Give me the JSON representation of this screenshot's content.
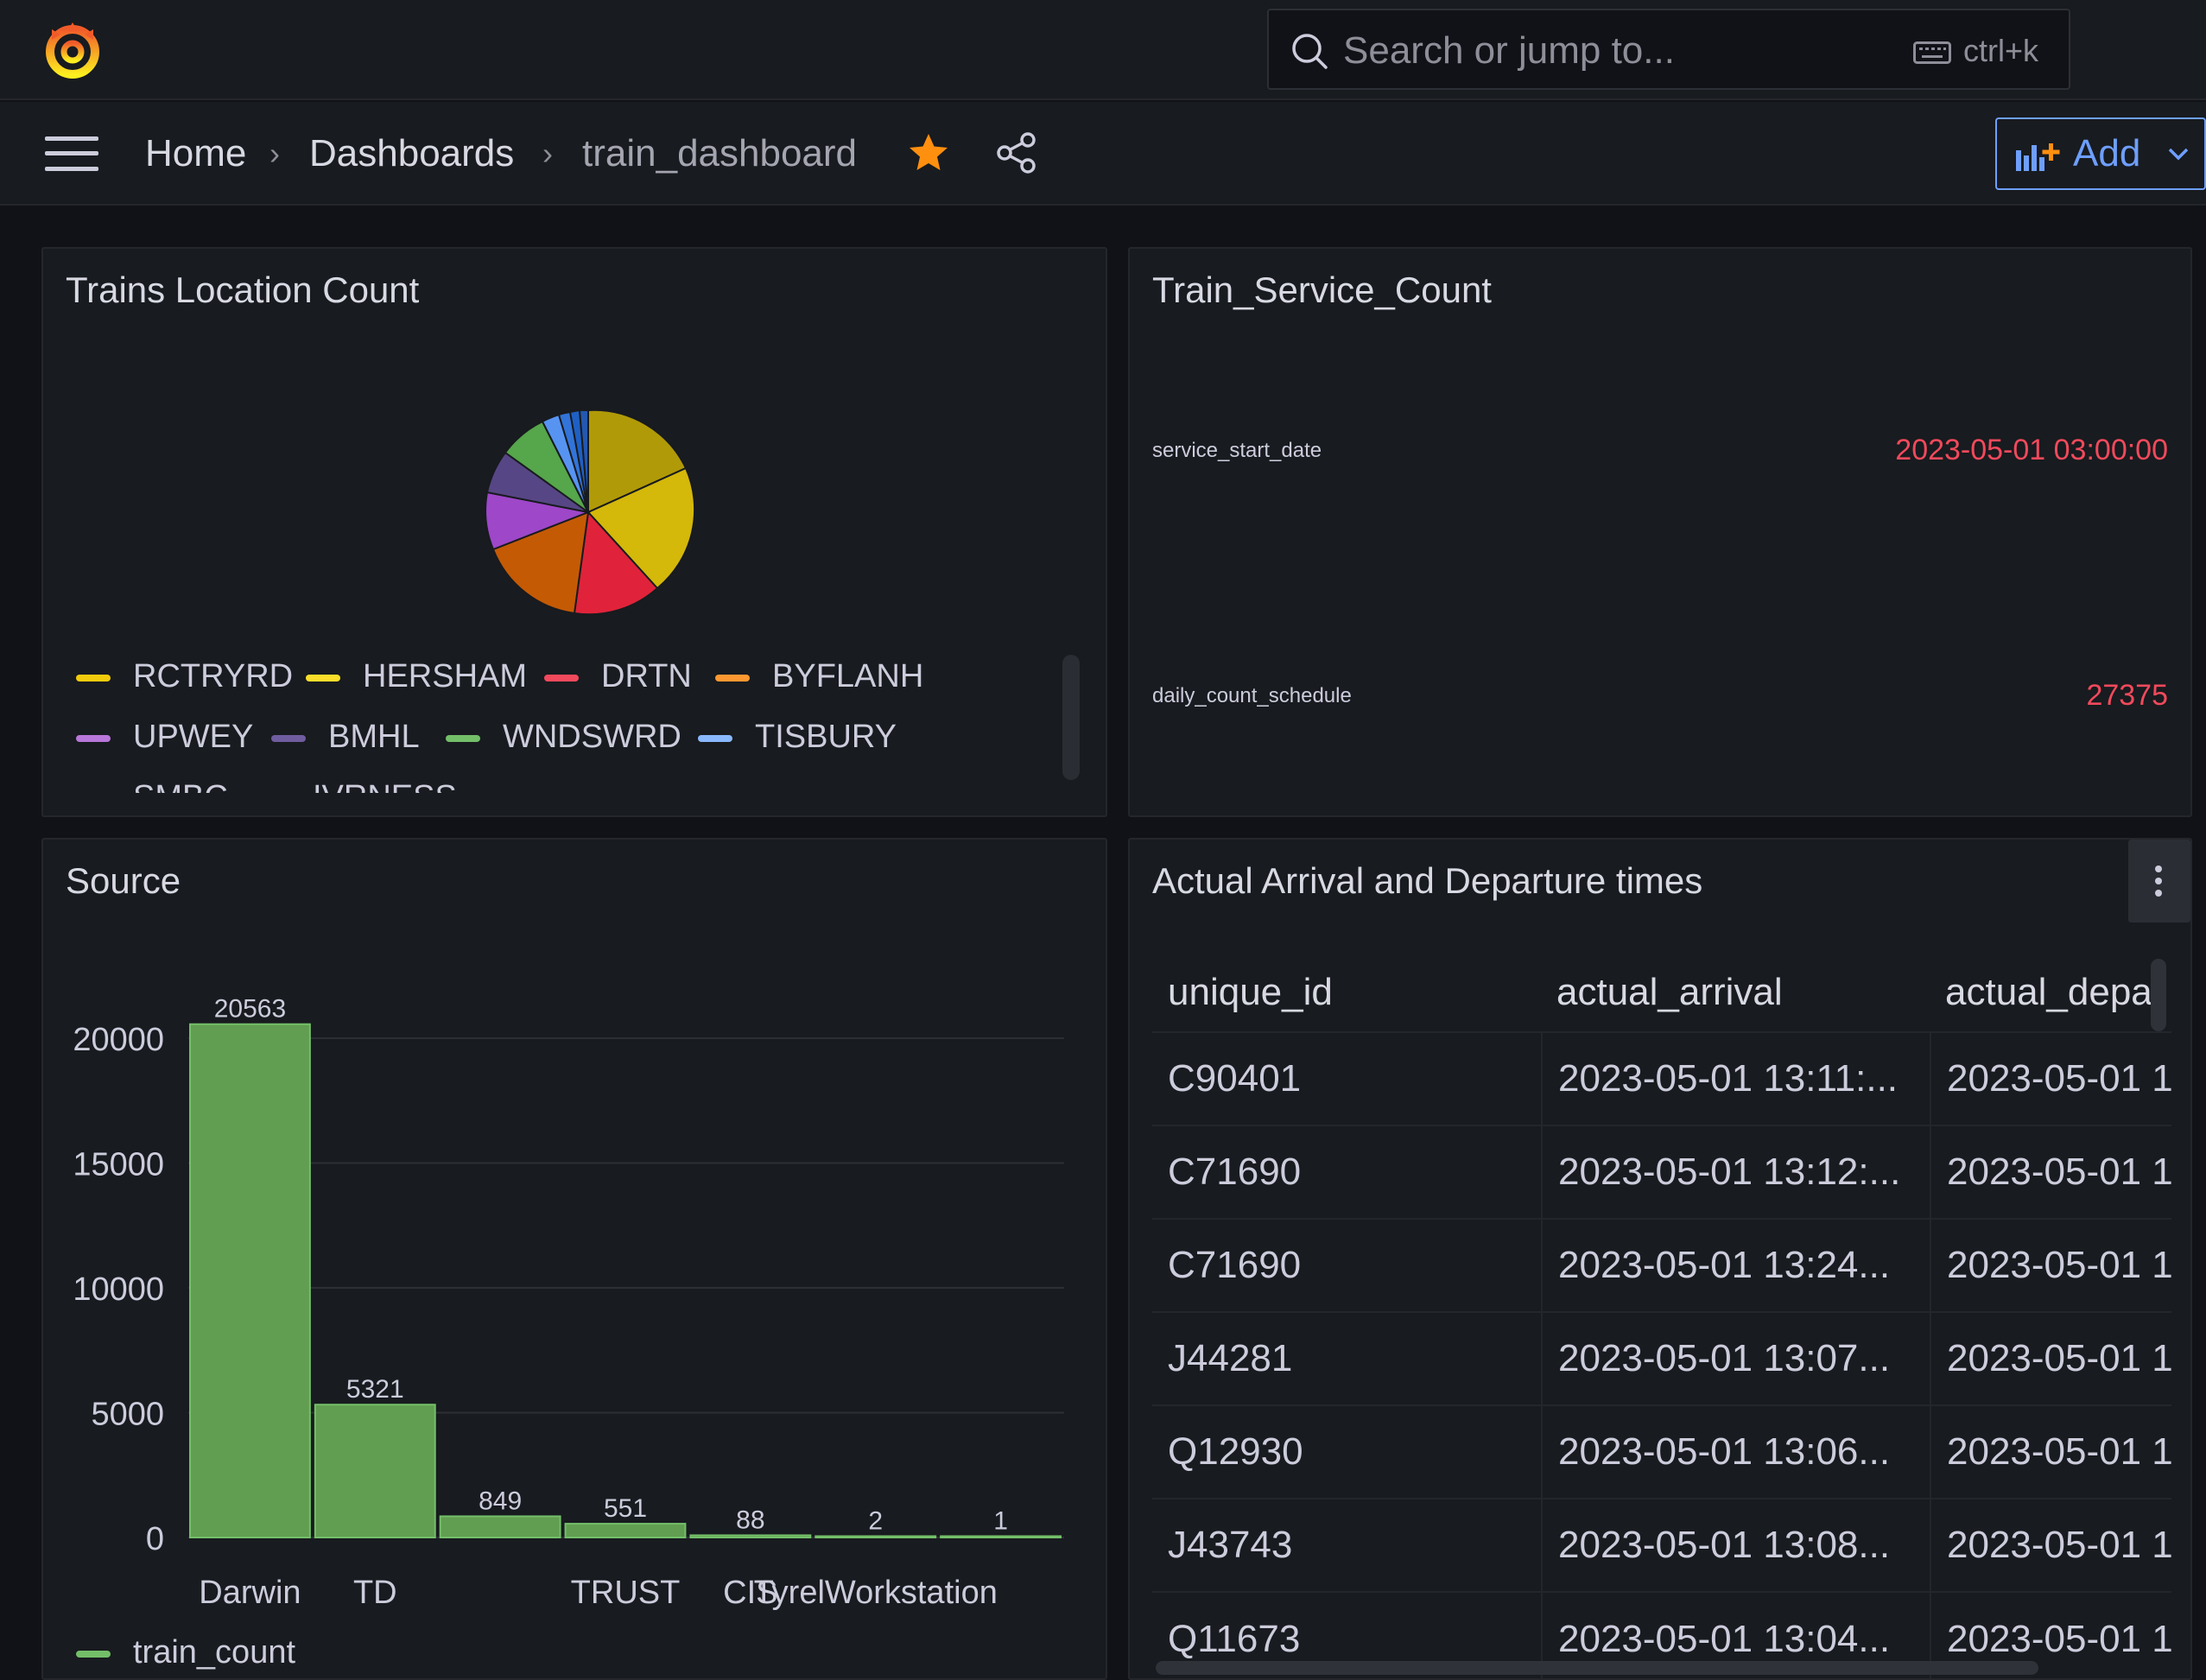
{
  "search": {
    "placeholder": "Search or jump to...",
    "shortcut": "ctrl+k"
  },
  "breadcrumb": {
    "home": "Home",
    "dashboards": "Dashboards",
    "current": "train_dashboard"
  },
  "toolbar": {
    "add_label": "Add"
  },
  "colors": {
    "accent": "#6e9fff",
    "star": "#ff8f0f",
    "stat_value": "#f2495c",
    "bar": "#73bf69"
  },
  "pie_panel": {
    "title": "Trains Location Count",
    "legend": [
      {
        "label": "RCTRYRD",
        "color": "#f2cc0c"
      },
      {
        "label": "HERSHAM",
        "color": "#fade2a"
      },
      {
        "label": "DRTN",
        "color": "#f2495c"
      },
      {
        "label": "BYFLANH",
        "color": "#ff9830"
      },
      {
        "label": "UPWEY",
        "color": "#b877d9"
      },
      {
        "label": "BMHL",
        "color": "#705da0"
      },
      {
        "label": "WNDSWRD",
        "color": "#73bf69"
      },
      {
        "label": "TISBURY",
        "color": "#8ab8ff"
      },
      {
        "label": "SMBC",
        "color": "#3274d9"
      },
      {
        "label": "IVRNESS",
        "color": "#1f60c4"
      }
    ]
  },
  "stat_panel": {
    "title": "Train_Service_Count",
    "stats": [
      {
        "label": "service_start_date",
        "value": "2023-05-01 03:00:00"
      },
      {
        "label": "daily_count_schedule",
        "value": "27375"
      }
    ]
  },
  "bar_panel": {
    "title": "Source",
    "legend_label": "train_count"
  },
  "chart_data": {
    "type": "bar",
    "title": "Source",
    "categories": [
      "Darwin",
      "TD",
      "",
      "TRUST",
      "CIS",
      "TyrelWorkstation",
      ""
    ],
    "series": [
      {
        "name": "train_count",
        "values": [
          20563,
          5321,
          849,
          551,
          88,
          2,
          1
        ]
      }
    ],
    "ylim": [
      0,
      22000
    ],
    "yticks": [
      0,
      5000,
      10000,
      15000,
      20000
    ],
    "grid": true,
    "legend": "bottom-left"
  },
  "table_panel": {
    "title": "Actual Arrival and Departure times",
    "columns": [
      "unique_id",
      "actual_arrival",
      "actual_depar"
    ],
    "rows": [
      [
        "C90401",
        "2023-05-01 13:11:...",
        "2023-05-01 1"
      ],
      [
        "C71690",
        "2023-05-01 13:12:...",
        "2023-05-01 1"
      ],
      [
        "C71690",
        "2023-05-01 13:24...",
        "2023-05-01 1"
      ],
      [
        "J44281",
        "2023-05-01 13:07...",
        "2023-05-01 1"
      ],
      [
        "Q12930",
        "2023-05-01 13:06...",
        "2023-05-01 1"
      ],
      [
        "J43743",
        "2023-05-01 13:08...",
        "2023-05-01 1"
      ],
      [
        "Q11673",
        "2023-05-01 13:04...",
        "2023-05-01 1"
      ]
    ]
  }
}
